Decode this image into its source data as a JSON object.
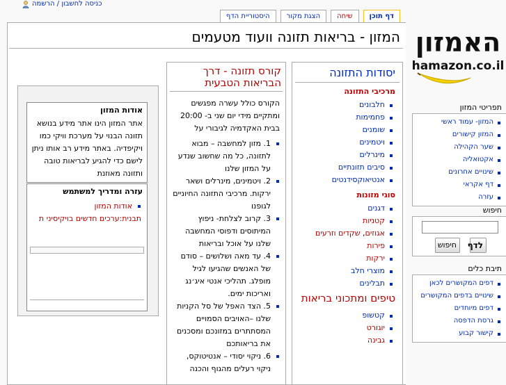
{
  "personal": {
    "text": "כניסה לחשבון / הרשמה",
    "icon": "user-icon"
  },
  "tabs": [
    {
      "label": "דף תוכן",
      "selected": true
    },
    {
      "label": "שיחה",
      "talk": true
    },
    {
      "label": "הצגת מקור"
    },
    {
      "label": "היסטוריית הדף"
    }
  ],
  "logo": {
    "main": "האמזון",
    "sub": "hamazon.co.il"
  },
  "page": {
    "title": "המזון - בריאות תזונה וועוד מטעמים"
  },
  "col1": {
    "title": "יסודות התזונה",
    "section1": "מרכיבי התזונה",
    "items1": [
      "חלבונים",
      "פחמימות",
      "שומנים",
      "ויטמינים",
      "מינרלים",
      "סיבים תזונתיים",
      "אנטיאוקסידנטים"
    ],
    "section2": "סוגי מזונות",
    "items2": [
      "דגנים",
      "קטניות"
    ],
    "nuts": {
      "a": "אגוזים",
      "sep": ", ",
      "b": "שקדים",
      "c": " וזרעים"
    },
    "items3": [
      "פירות",
      "ירקות",
      "מוצרי חלב",
      "תבלינים"
    ],
    "section3": "טיפים ומתכוני בריאות",
    "items4": [
      "קטשופ",
      "יוגורט",
      "גבינה"
    ]
  },
  "col2": {
    "title": "קורס תזונה - דרך הבריאות הטבעית",
    "intro": "הקורס כולל עשרה מפגשים ומתקיים מידי יום שני ב- 20:00 בבית האקדמיה לגיבורי על",
    "items": [
      "1. מזון למחשבה – מבוא לתזונה, כל מה שחשוב שנדע על המזון שלנו",
      "2. ויטמינים, מינרלים ושאר ירקות. מרכיבי התזונה החיוניים לגופנו",
      "3. קרוב לצלחת- ניפוץ המיתוסים ודפוסי המחשבה שלנו על אוכל ובריאות",
      "4. עד מאה ושלושים – סודם של האנשים שהגיעו לגיל מופלג. תהליכי אנטי איג׳נג ואריכות ימים.",
      "5. הצד האפל של סל הקניות שלנו –האויבים הסמויים המסתתרים במזונכם ומסכנים את בריאותכם",
      "6. ניקוי יסודי – אנטיטוקס, ניקוי רעלים מהגוף והכנה"
    ]
  },
  "col3": {
    "about_title": "אודות המזון",
    "about_text": "אתר המזון הינו אתר מידע בנושא תזונה הבנוי על מערכת וויקי כמו ויקיפדיה. באתר מידע רב אותו ניתן לישם כדי להגיע לבריאות טובה ותזונה מאוזנת",
    "help_title": "עזרה ומדריך למשתמש",
    "help_item1": "אודות המזון",
    "help_item2": "תבנית:ערכים חדשים בויקיסיני ת"
  },
  "sidebar": {
    "nav_title": "תפריטי המזון",
    "nav_items": [
      "המזון- עמוד ראשי",
      "המזון קישורים",
      "שער הקהילה",
      "אקטואליה",
      "שינויים אחרונים",
      "דף אקראי",
      "עזרה"
    ],
    "search_title": "חיפוש",
    "go_label": "לדף",
    "search_label": "חיפוש",
    "tb_title": "תיבת כלים",
    "tb_items": [
      "דפים המקושרים לכאן",
      "שינויים בדפים המקושרים",
      "דפים מיוחדים",
      "גרסת הדפסה",
      "קישור קבוע"
    ]
  }
}
